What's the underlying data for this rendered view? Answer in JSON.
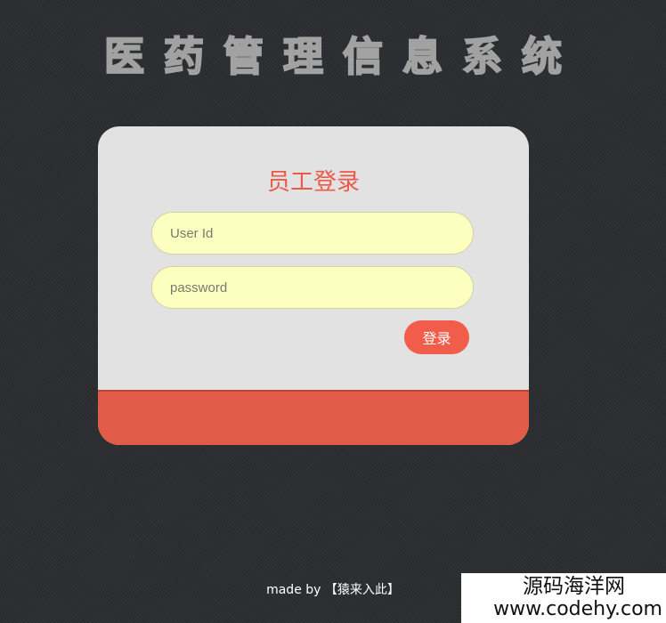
{
  "header": {
    "title": "医药管理信息系统"
  },
  "login": {
    "title": "员工登录",
    "user_placeholder": "User Id",
    "password_placeholder": "password",
    "submit_label": "登录"
  },
  "footer": {
    "text": "made by 【猿来入此】"
  },
  "watermark": {
    "line1": "源码海洋网",
    "line2": "www.codehy.com"
  },
  "colors": {
    "background": "#2c2f31",
    "card": "#e2e2e2",
    "accent": "#e95a48",
    "input_fill": "#fdffc0"
  }
}
